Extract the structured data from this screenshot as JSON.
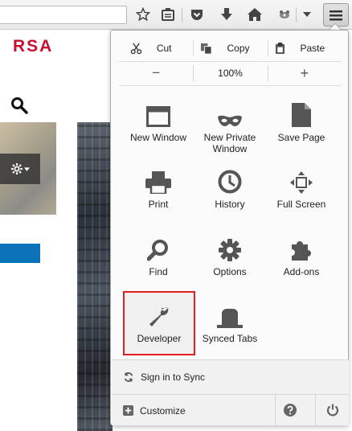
{
  "toolbar": {
    "url_value": "",
    "icons": [
      "star-icon",
      "reading-list-icon",
      "pocket-icon",
      "download-icon",
      "home-icon",
      "addon-icon",
      "dropdown-icon",
      "hamburger-menu-icon"
    ]
  },
  "page": {
    "brand": "RSA"
  },
  "menu": {
    "edit": {
      "cut": "Cut",
      "copy": "Copy",
      "paste": "Paste"
    },
    "zoom": {
      "minus": "−",
      "level": "100%",
      "plus": "+"
    },
    "items": {
      "new_window": "New Window",
      "new_private_window": "New Private Window",
      "save_page": "Save Page",
      "print": "Print",
      "history": "History",
      "full_screen": "Full Screen",
      "find": "Find",
      "options": "Options",
      "addons": "Add-ons",
      "developer": "Developer",
      "synced_tabs": "Synced Tabs"
    },
    "sync_label": "Sign in to Sync",
    "customize_label": "Customize",
    "highlight_color": "#e02020"
  }
}
